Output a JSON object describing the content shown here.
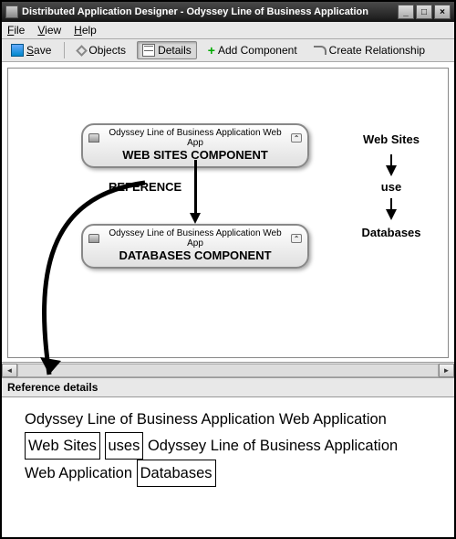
{
  "window": {
    "title": "Distributed Application Designer - Odyssey Line of Business Application"
  },
  "menu": {
    "file": "File",
    "view": "View",
    "help": "Help"
  },
  "toolbar": {
    "save": "Save",
    "objects": "Objects",
    "details": "Details",
    "add_component": "Add Component",
    "create_relationship": "Create Relationship"
  },
  "diagram": {
    "top_component": {
      "subtitle": "Odyssey Line of Business Application Web App",
      "title": "WEB SITES COMPONENT"
    },
    "bottom_component": {
      "subtitle": "Odyssey Line of Business Application Web App",
      "title": "DATABASES COMPONENT"
    },
    "reference_label": "REFERENCE",
    "side": {
      "top": "Web Sites",
      "mid": "use",
      "bottom": "Databases"
    }
  },
  "details": {
    "header": "Reference details",
    "line1_a": "Odyssey Line of Business Application Web Application",
    "box1": "Web Sites",
    "box2": "uses",
    "line2_a": "Odyssey Line of Business Application",
    "line3_a": "Web Application",
    "box3": "Databases"
  }
}
